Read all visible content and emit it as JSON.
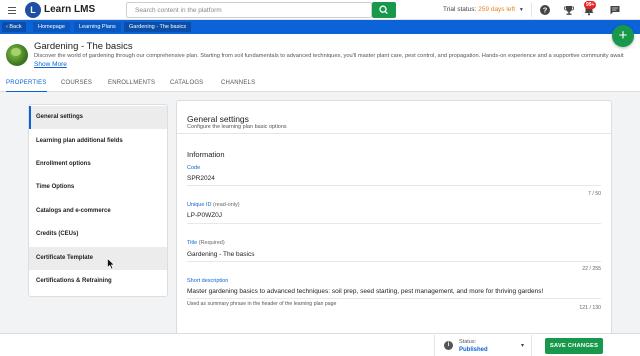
{
  "app": {
    "name": "Learn LMS",
    "logo_letter": "L"
  },
  "topbar": {
    "search_placeholder": "Search content in the platform",
    "trial_label": "Trial status:",
    "trial_days": "259 days left",
    "notification_count": "99+"
  },
  "breadcrumb": {
    "back": "Back",
    "items": [
      "Homepage",
      "Learning Plans",
      "Gardening - The basics"
    ]
  },
  "learning_plan": {
    "title": "Gardening - The basics",
    "description": "Discover the world of gardening through our comprehensive plan. Starting from soil fundamentals to advanced techniques, you'll master plant care, pest control, and propagation. Hands-on experience and a supportive community await as you e",
    "show_more": "Show More"
  },
  "tabs": [
    {
      "label": "PROPERTIES",
      "active": true
    },
    {
      "label": "COURSES",
      "active": false
    },
    {
      "label": "ENROLLMENTS",
      "active": false
    },
    {
      "label": "CATALOGS",
      "active": false
    },
    {
      "label": "CHANNELS",
      "active": false
    }
  ],
  "sidemenu": [
    "General settings",
    "Learning plan additional fields",
    "Enrollment options",
    "Time Options",
    "Catalogs and e-commerce",
    "Credits (CEUs)",
    "Certificate Template",
    "Certifications & Retraining"
  ],
  "panel": {
    "title": "General settings",
    "subtitle": "Configure the learning plan basic options",
    "section": "Information",
    "code_label": "Code",
    "code_value": "SPR2024",
    "code_count": "7 / 50",
    "uid_label": "Unique ID",
    "uid_note": "(read-only)",
    "uid_value": "LP-P0WZ0J",
    "title_label": "Title",
    "title_note": "(Required)",
    "title_value": "Gardening - The basics",
    "title_count": "22 / 255",
    "desc_label": "Short description",
    "desc_value": "Master gardening basics to advanced techniques: soil prep, seed starting, pest management, and more for thriving gardens!",
    "desc_hint": "Used as summary phrase in the header of the learning plan page",
    "desc_count": "121 / 130"
  },
  "bottombar": {
    "status_label": "Status:",
    "status_value": "Published",
    "save": "SAVE CHANGES"
  },
  "colors": {
    "brand_blue": "#0c63d8",
    "green": "#17984b",
    "trial_orange": "#e7831c"
  }
}
